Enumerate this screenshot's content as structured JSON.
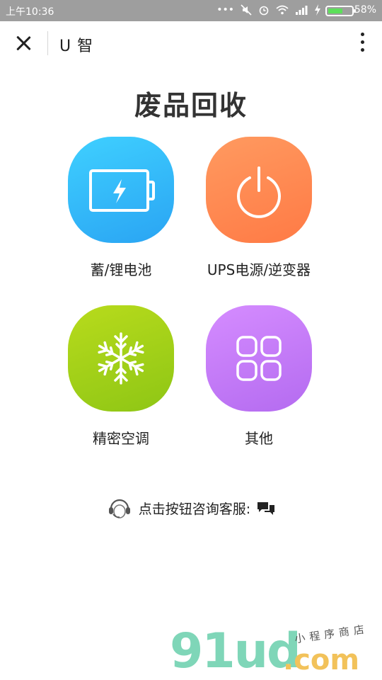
{
  "status_bar": {
    "time": "上午10:36",
    "icons": [
      "more-dots",
      "mute",
      "alarm",
      "wifi",
      "signal",
      "charging"
    ],
    "battery_level": 0.58,
    "battery_percent": "58%"
  },
  "title_bar": {
    "title": "U 智"
  },
  "page": {
    "title": "废品回收"
  },
  "categories": [
    {
      "label": "蓄/锂电池",
      "icon": "battery-icon",
      "color": "#33b8fa"
    },
    {
      "label": "UPS电源/逆变器",
      "icon": "power-icon",
      "color": "#ff8a50"
    },
    {
      "label": "精密空调",
      "icon": "snowflake-icon",
      "color": "#a6d219"
    },
    {
      "label": "其他",
      "icon": "grid-icon",
      "color": "#c67cf8"
    }
  ],
  "contact": {
    "text": "点击按钮咨询客服:",
    "icon_left": "headset-icon",
    "icon_right": "chat-icon"
  },
  "watermark": {
    "brand": "91ud",
    "domain": ".com",
    "tagline": "小程序商店"
  }
}
